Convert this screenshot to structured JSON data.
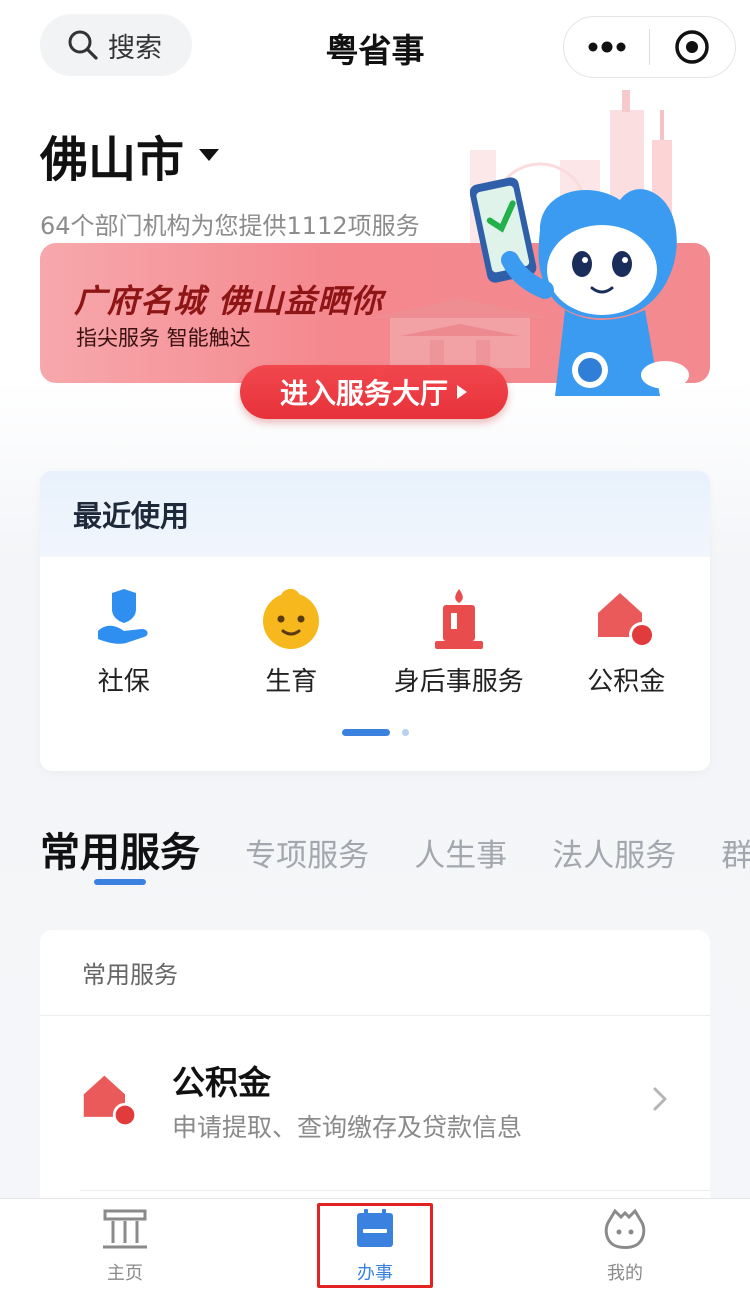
{
  "header": {
    "search_label": "搜索",
    "title": "粤省事",
    "search_icon": "search-icon",
    "more_icon": "more-dots-icon",
    "close_icon": "target-close-icon"
  },
  "city": {
    "name": "佛山市",
    "subtitle": "64个部门机构为您提供1112项服务"
  },
  "banner": {
    "title": "广府名城 佛山益晒你",
    "subtitle": "指尖服务 智能触达",
    "button_label": "进入服务大厅",
    "colors": {
      "button": "#e7323a",
      "title": "#8e1515"
    }
  },
  "recent": {
    "title": "最近使用",
    "items": [
      {
        "label": "社保",
        "icon": "social-security-icon"
      },
      {
        "label": "生育",
        "icon": "baby-face-icon"
      },
      {
        "label": "身后事服务",
        "icon": "candle-icon"
      },
      {
        "label": "公积金",
        "icon": "housing-fund-icon"
      }
    ]
  },
  "tabs": [
    {
      "label": "常用服务",
      "active": true
    },
    {
      "label": "专项服务"
    },
    {
      "label": "人生事"
    },
    {
      "label": "法人服务"
    },
    {
      "label": "群体"
    }
  ],
  "services": {
    "section_title": "常用服务",
    "items": [
      {
        "name": "公积金",
        "description": "申请提取、查询缴存及贷款信息",
        "icon": "housing-fund-icon"
      }
    ]
  },
  "tabbar": {
    "items": [
      {
        "label": "主页",
        "icon": "home-icon"
      },
      {
        "label": "办事",
        "icon": "calendar-icon",
        "active": true
      },
      {
        "label": "我的",
        "icon": "profile-icon"
      }
    ],
    "accent": "#3b82e0"
  }
}
